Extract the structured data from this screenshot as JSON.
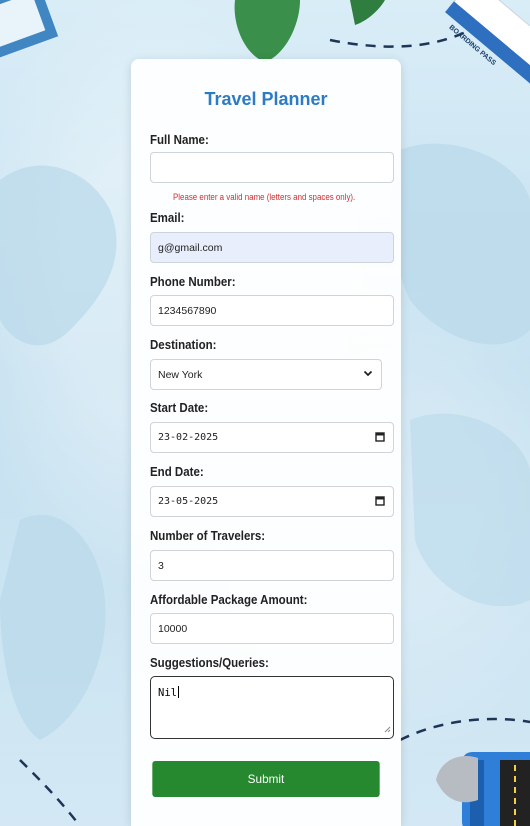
{
  "form": {
    "title": "Travel Planner",
    "full_name_label": "Full Name:",
    "full_name_value": "",
    "full_name_error": "Please enter a valid name (letters and spaces only).",
    "email_label": "Email:",
    "email_value": "g@gmail.com",
    "phone_label": "Phone Number:",
    "phone_value": "1234567890",
    "destination_label": "Destination:",
    "destination_value": "New York",
    "start_date_label": "Start Date:",
    "start_date_value": "23-02-2025",
    "end_date_label": "End Date:",
    "end_date_value": "23-05-2025",
    "travelers_label": "Number of Travelers:",
    "travelers_value": "3",
    "package_label": "Affordable Package Amount:",
    "package_value": "10000",
    "queries_label": "Suggestions/Queries:",
    "queries_value": "Nil",
    "submit_label": "Submit"
  },
  "background": {
    "ticket_text": "BOARDING PASS"
  },
  "colors": {
    "title": "#2d7bc4",
    "error": "#d32f2f",
    "submit": "#27892f",
    "autofill": "#e8eefb"
  }
}
